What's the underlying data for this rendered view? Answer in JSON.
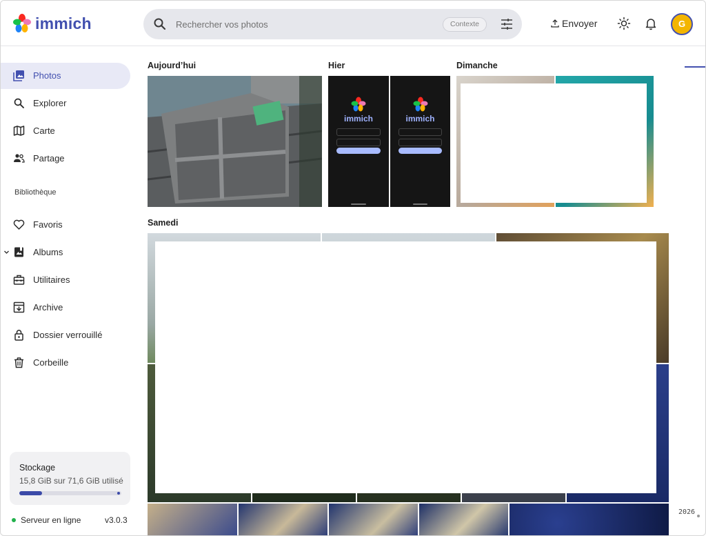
{
  "app": {
    "name": "immich"
  },
  "header": {
    "search_placeholder": "Rechercher vos photos",
    "context_label": "Contexte",
    "upload_label": "Envoyer",
    "avatar_initial": "G"
  },
  "sidebar": {
    "items": [
      {
        "label": "Photos",
        "icon": "photos-icon",
        "active": true
      },
      {
        "label": "Explorer",
        "icon": "search-icon"
      },
      {
        "label": "Carte",
        "icon": "map-icon"
      },
      {
        "label": "Partage",
        "icon": "people-icon"
      }
    ],
    "library_label": "Bibliothèque",
    "library_items": [
      {
        "label": "Favoris",
        "icon": "heart-icon"
      },
      {
        "label": "Albums",
        "icon": "album-icon"
      },
      {
        "label": "Utilitaires",
        "icon": "toolbox-icon"
      },
      {
        "label": "Archive",
        "icon": "archive-icon"
      },
      {
        "label": "Dossier verrouillé",
        "icon": "lock-icon"
      },
      {
        "label": "Corbeille",
        "icon": "trash-icon"
      }
    ],
    "storage": {
      "title": "Stockage",
      "usage": "15,8 GiB sur 71,6 GiB utilisé",
      "fraction": 0.22
    },
    "server_status": "Serveur en ligne",
    "version": "v3.0.3"
  },
  "timeline": {
    "groups": [
      {
        "title": "Aujourd’hui"
      },
      {
        "title": "Hier"
      },
      {
        "title": "Dimanche"
      },
      {
        "title": "Samedi"
      }
    ],
    "phone_app_text": "immich",
    "year_marker": "2026"
  },
  "colors": {
    "accent": "#4250af",
    "active_bg": "#e8e9f6",
    "online": "#22b14c",
    "avatar": "#f3b500"
  }
}
